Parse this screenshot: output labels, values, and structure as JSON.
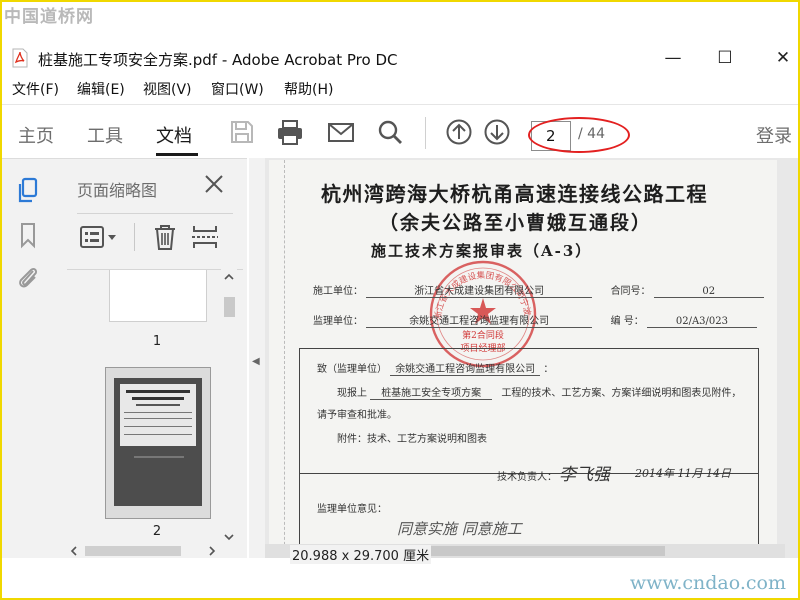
{
  "watermark": {
    "top_left": "中国道桥网",
    "bottom_right": "www.cndao.com"
  },
  "window": {
    "title": "桩基施工专项安全方案.pdf - Adobe Acrobat Pro DC",
    "minimize": "—",
    "maximize": "☐",
    "close": "✕"
  },
  "menu": [
    "文件(F)",
    "编辑(E)",
    "视图(V)",
    "窗口(W)",
    "帮助(H)"
  ],
  "toolbar": {
    "tabs": [
      "主页",
      "工具",
      "文档"
    ],
    "active_tab": "文档",
    "page_current": "2",
    "page_total": "/ 44",
    "login": "登录",
    "annotation_color": "#e32020"
  },
  "thumb_panel": {
    "title": "页面缩略图",
    "thumbnails": [
      {
        "label": "1"
      },
      {
        "label": "2",
        "selected": true
      }
    ]
  },
  "document": {
    "title_line1": "杭州湾跨海大桥杭甬高速连接线公路工程",
    "title_line2": "（余夫公路至小曹娥互通段）",
    "title_line3": "施工技术方案报审表（A-3）",
    "construction_unit_label": "施工单位：",
    "construction_unit_value": "浙江省大成建设集团有限公司",
    "contract_no_label": "合同号：",
    "contract_no_value": "02",
    "supervision_unit_label": "监理单位：",
    "supervision_unit_value": "余姚交通工程咨询监理有限公司",
    "serial_no_label": "编    号：",
    "serial_no_value": "02/A3/023",
    "to_label": "致（监理单位）",
    "to_value": "余姚交通工程咨询监理有限公司",
    "to_suffix": "：",
    "body_prefix": "现报上",
    "body_item": "桩基施工安全专项方案",
    "body_suffix": "工程的技术、工艺方案、方案详细说明和图表见附件，",
    "body_line2": "请予审查和批准。",
    "attachment": "附件：技术、工艺方案说明和图表",
    "tech_lead_label": "技术负责人：",
    "tech_lead_signature": "李飞强",
    "date_sign": "2014年  11月 14日",
    "supervisor_opinion_label": "监理单位意见：",
    "supervisor_handwriting": "同意实施 同意施工",
    "stamp_text": "浙江省大成建设集团有限公司宁波余慈项目部",
    "stamp_sub1": "第2合同段",
    "stamp_sub2": "项目经理部",
    "stamp_color": "#d23c3c"
  },
  "status": {
    "page_size": "20.988 x 29.700 厘米"
  }
}
